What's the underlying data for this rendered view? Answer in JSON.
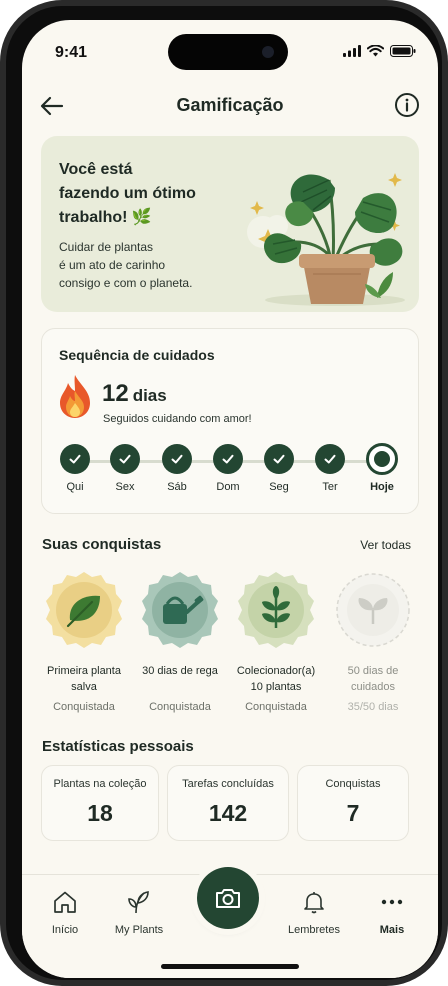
{
  "status": {
    "time": "9:41"
  },
  "header": {
    "title": "Gamificação"
  },
  "hero": {
    "title_lines": [
      "Você está",
      "fazendo um ótimo",
      "trabalho! 🌿"
    ],
    "text_lines": [
      "Cuidar de plantas",
      "é um ato de carinho",
      "consigo e com o planeta."
    ]
  },
  "streak": {
    "title": "Sequência de cuidados",
    "count": "12",
    "unit": "dias",
    "subtitle": "Seguidos cuidando com amor!",
    "days": [
      {
        "label": "Qui",
        "done": true
      },
      {
        "label": "Sex",
        "done": true
      },
      {
        "label": "Sáb",
        "done": true
      },
      {
        "label": "Dom",
        "done": true
      },
      {
        "label": "Seg",
        "done": true
      },
      {
        "label": "Ter",
        "done": true
      },
      {
        "label": "Hoje",
        "done": false
      }
    ]
  },
  "achievements": {
    "title": "Suas conquistas",
    "see_all": "Ver todas",
    "items": [
      {
        "name_lines": [
          "Primeira planta",
          "salva"
        ],
        "status": "Conquistada",
        "icon": "leaf-icon",
        "color": "#e9cf85"
      },
      {
        "name_lines": [
          "30 dias de rega",
          ""
        ],
        "status": "Conquistada",
        "icon": "watering-can-icon",
        "color": "#8fb3a3"
      },
      {
        "name_lines": [
          "Colecionador(a)",
          "10 plantas"
        ],
        "status": "Conquistada",
        "icon": "sprout-icon",
        "color": "#c4d3a8"
      },
      {
        "name_lines": [
          "50 dias de",
          "cuidados"
        ],
        "status": "35/50 dias",
        "icon": "sprout-icon",
        "color": "#e6e5df"
      }
    ]
  },
  "stats": {
    "title": "Estatísticas pessoais",
    "items": [
      {
        "label": "Plantas na coleção",
        "value": "18"
      },
      {
        "label": "Tarefas concluídas",
        "value": "142"
      },
      {
        "label": "Conquistas",
        "value": "7"
      }
    ]
  },
  "tabs": {
    "home": "Início",
    "plants": "My Plants",
    "reminders": "Lembretes",
    "more": "Mais"
  },
  "colors": {
    "primary": "#234632",
    "background": "#faf8f1",
    "hero_bg": "#e9ecda"
  }
}
